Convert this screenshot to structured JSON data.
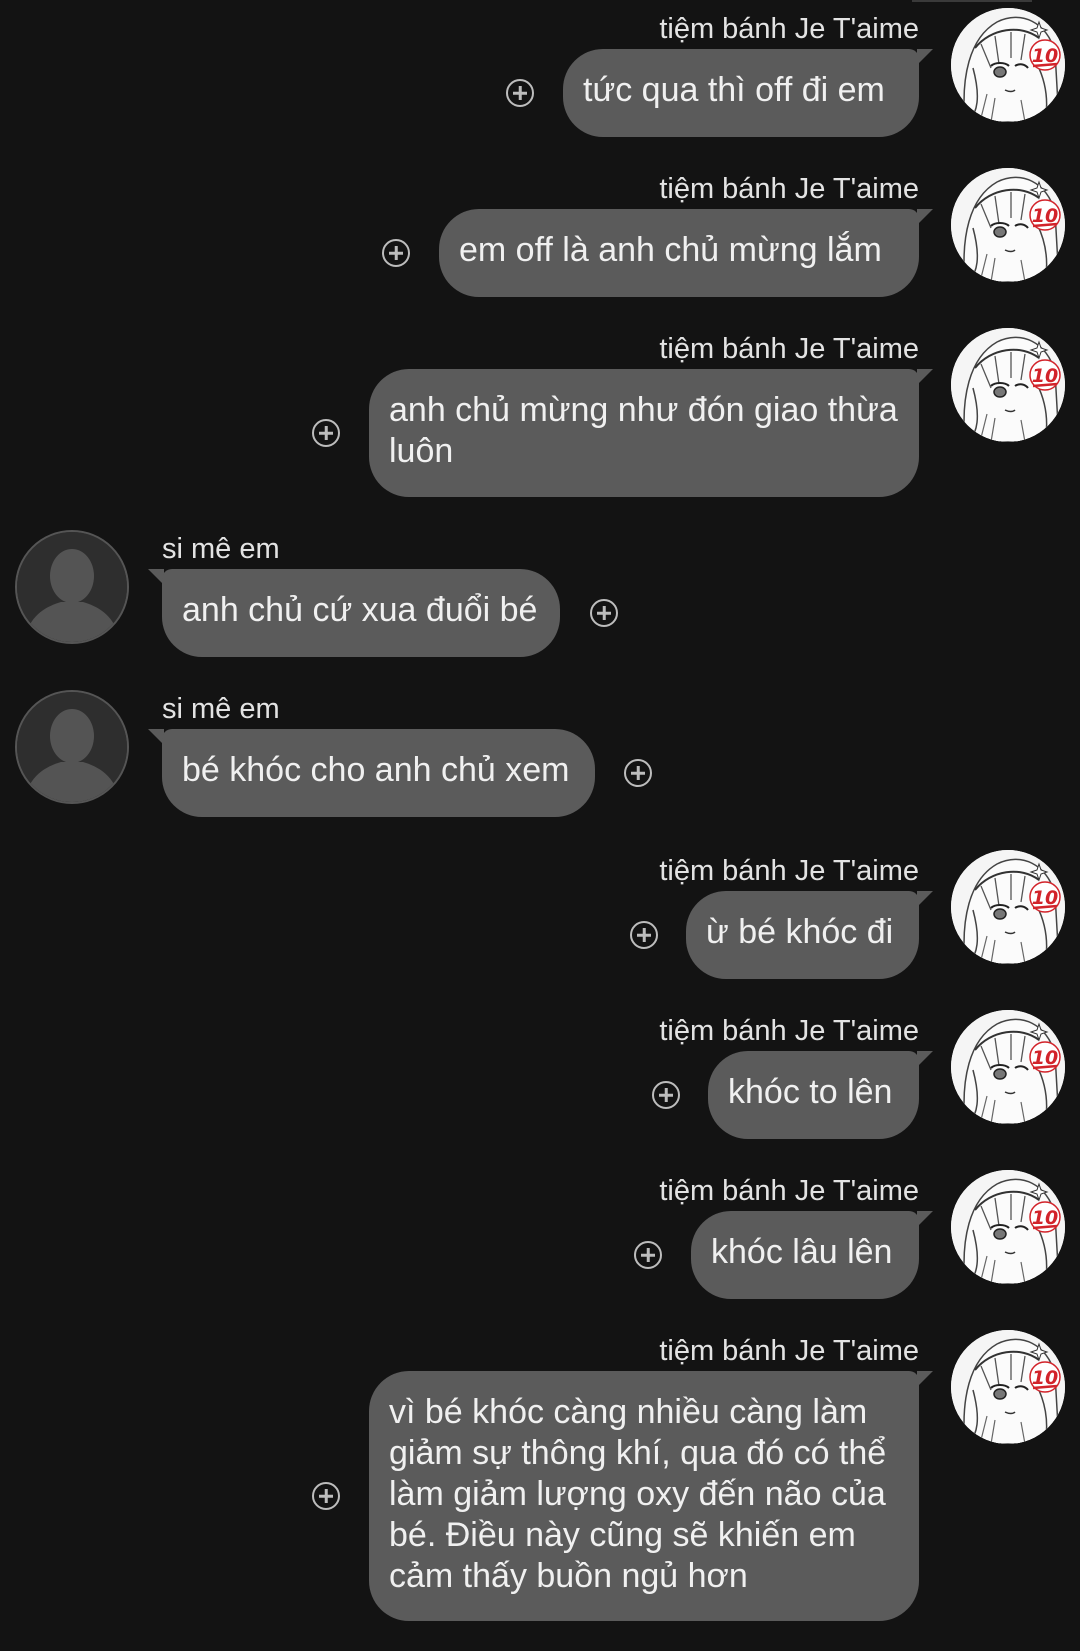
{
  "conversation": {
    "messages": [
      {
        "side": "mine",
        "sender": "tiệm bánh Je T'aime",
        "text": "tức qua thì off đi em",
        "avatar": "anime-girl-avatar-with-10-badge"
      },
      {
        "side": "mine",
        "sender": "tiệm bánh Je T'aime",
        "text": "em off là anh chủ mừng lắm",
        "avatar": "anime-girl-avatar-with-10-badge"
      },
      {
        "side": "mine",
        "sender": "tiệm bánh Je T'aime",
        "text": "anh chủ mừng như đón giao thừa luôn",
        "avatar": "anime-girl-avatar-with-10-badge"
      },
      {
        "side": "theirs",
        "sender": "si mê em",
        "text": "anh chủ cứ xua đuổi bé",
        "avatar": "default-person-avatar"
      },
      {
        "side": "theirs",
        "sender": "si mê em",
        "text": "bé khóc cho anh chủ xem",
        "avatar": "default-person-avatar"
      },
      {
        "side": "mine",
        "sender": "tiệm bánh Je T'aime",
        "text": "ừ bé khóc đi",
        "avatar": "anime-girl-avatar-with-10-badge"
      },
      {
        "side": "mine",
        "sender": "tiệm bánh Je T'aime",
        "text": "khóc to lên",
        "avatar": "anime-girl-avatar-with-10-badge"
      },
      {
        "side": "mine",
        "sender": "tiệm bánh Je T'aime",
        "text": "khóc lâu lên",
        "avatar": "anime-girl-avatar-with-10-badge"
      },
      {
        "side": "mine",
        "sender": "tiệm bánh Je T'aime",
        "text": "vì bé khóc càng nhiều càng làm giảm sự thông khí, qua đó có thể làm giảm lượng oxy đến não của bé. Điều này cũng sẽ khiến em cảm thấy buồn ngủ hơn",
        "avatar": "anime-girl-avatar-with-10-badge"
      }
    ],
    "badge_text": "10",
    "react_icon": "plus-circle-icon"
  },
  "colors": {
    "background": "#131313",
    "bubble": "#5b5b5b",
    "text": "#f0f0f0",
    "sender_name": "#e3e3e3",
    "badge_red": "#d2232a"
  }
}
